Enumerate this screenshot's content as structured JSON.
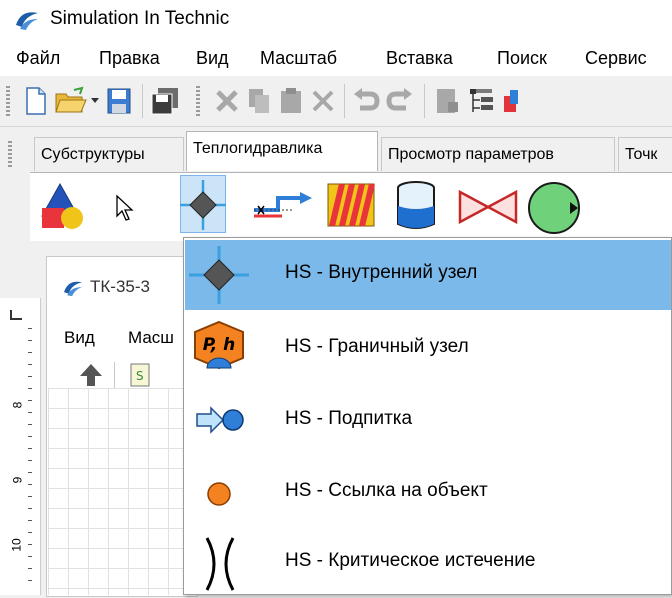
{
  "app": {
    "title": "Simulation In Technic",
    "logo_icon": "sit-logo-icon"
  },
  "menu": [
    "Файл",
    "Правка",
    "Вид",
    "Масштаб",
    "Вставка",
    "Поиск",
    "Сервис"
  ],
  "tabs": [
    {
      "label": "Субструктуры",
      "active": false
    },
    {
      "label": "Теплогидравлика",
      "active": true
    },
    {
      "label": "Просмотр параметров",
      "active": false
    },
    {
      "label": "Точк",
      "active": false
    }
  ],
  "child_window": {
    "title": "ТК-35-3",
    "menu": [
      "Вид",
      "Масш"
    ],
    "ruler_labels": [
      "8",
      "9",
      "10"
    ]
  },
  "dropdown": {
    "items": [
      {
        "label": "HS - Внутренний узел",
        "icon": "internal-node-icon",
        "highlighted": true
      },
      {
        "label": "HS - Граничный узел",
        "icon": "boundary-node-icon",
        "icon_text": "P, h",
        "highlighted": false
      },
      {
        "label": "HS - Подпитка",
        "icon": "makeup-icon",
        "highlighted": false
      },
      {
        "label": "HS - Ссылка на объект",
        "icon": "object-link-icon",
        "highlighted": false
      },
      {
        "label": "HS - Критическое истечение",
        "icon": "critical-flow-icon",
        "highlighted": false
      }
    ]
  },
  "colors": {
    "highlight": "#7ab9ea",
    "orange": "#f58220",
    "blue": "#2f7fd8",
    "green": "#5cc46a",
    "red": "#e8343a"
  }
}
